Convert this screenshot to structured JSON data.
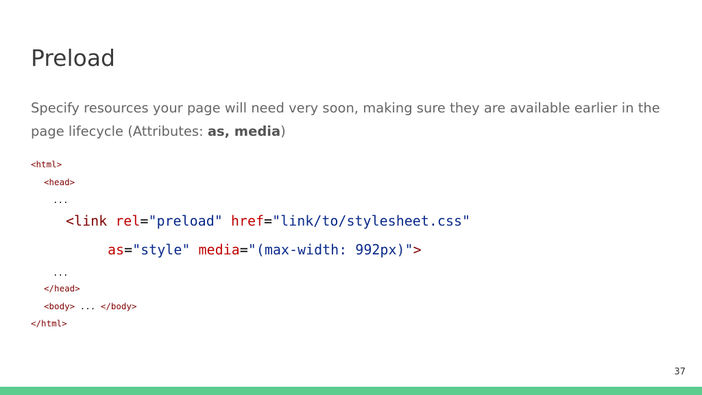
{
  "slide": {
    "title": "Preload",
    "description_prefix": "Specify resources your page will need very soon, making sure they are available earlier in the page lifecycle (Attributes: ",
    "description_bold": "as, media",
    "description_suffix": ")",
    "page_number": "37",
    "accent_color": "#5ccc8f"
  },
  "code": {
    "html_open": "<html>",
    "head_open": "<head>",
    "ellipsis_1": "...",
    "link_tag_open": "<link",
    "rel_attr": "rel",
    "eq_1": "=",
    "rel_value": "\"preload\"",
    "href_attr": "href",
    "eq_2": "=",
    "href_value": "\"link/to/stylesheet.css\"",
    "as_attr": "as",
    "eq_3": "=",
    "as_value": "\"style\"",
    "media_attr": "media",
    "eq_4": "=",
    "media_value": "\"(max-width: 992px)\"",
    "link_tag_close": ">",
    "ellipsis_2": "...",
    "head_close": "</head>",
    "body_open": "<body>",
    "body_ellipsis": " ... ",
    "body_close": "</body>",
    "html_close": "</html>"
  }
}
